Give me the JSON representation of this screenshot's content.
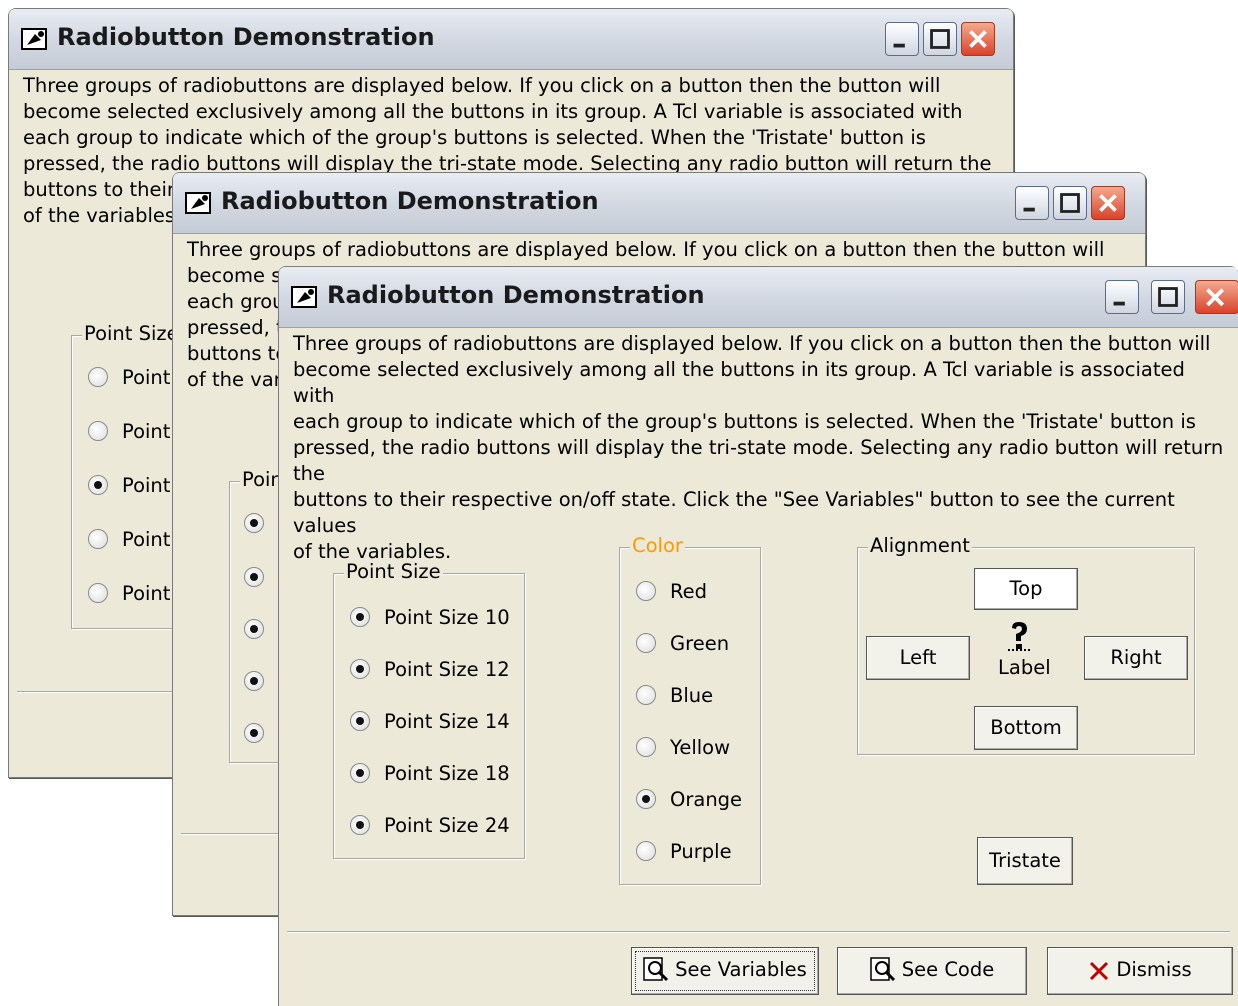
{
  "window": {
    "title": "Radiobutton Demonstration",
    "description": "Three groups of radiobuttons are displayed below.  If you click on a button then the button will\nbecome selected exclusively among all the buttons in its group.  A Tcl variable is associated with\neach group to indicate which of the group's buttons is selected.  When the 'Tristate' button is\npressed, the radio buttons will display the tri-state mode. Selecting any radio button will return the\nbuttons to their respective on/off state. Click the \"See Variables\" button to see the current values\nof the variables."
  },
  "back1": {
    "desc": "Three groups of radiobuttons are displayed below.  If you click on a button then the button will\nbecome selected exclusively among all the buttons in its group.  A Tcl variable is associated with\neach group to indicate which of the group's buttons is selected.  When the 'Tristate' button is\npressed, the radio buttons will display the tri-state mode. Selecting any radio button will return the\nbuttons to their\nof the variables",
    "group_label": "Point Size",
    "items": [
      "Point",
      "Point",
      "Point",
      "Point",
      "Point"
    ]
  },
  "back2": {
    "desc": "Three groups of radiobuttons are displayed below.  If you click on a button then the button will\nbecome se\neach grou\npressed, t\nbuttons to\nof the var",
    "group_label": "Poin"
  },
  "point_size": {
    "label": "Point Size",
    "items": [
      "Point Size 10",
      "Point Size 12",
      "Point Size 14",
      "Point Size 18",
      "Point Size 24"
    ]
  },
  "color": {
    "label": "Color",
    "label_color": "#ff9900",
    "items": [
      "Red",
      "Green",
      "Blue",
      "Yellow",
      "Orange",
      "Purple"
    ],
    "selected": "Orange"
  },
  "alignment": {
    "label": "Alignment",
    "top": "Top",
    "left": "Left",
    "right": "Right",
    "bottom": "Bottom",
    "center_label": "Label",
    "selected": "Top"
  },
  "tristate_label": "Tristate",
  "buttons": {
    "see_variables": "See Variables",
    "see_code": "See Code",
    "dismiss": "Dismiss"
  },
  "icons": {
    "title": "window-demo-icon",
    "center": "question-mark-bitmap-icon",
    "see_variables": "magnifier-icon",
    "see_code": "magnifier-icon",
    "dismiss": "x-close-icon"
  }
}
